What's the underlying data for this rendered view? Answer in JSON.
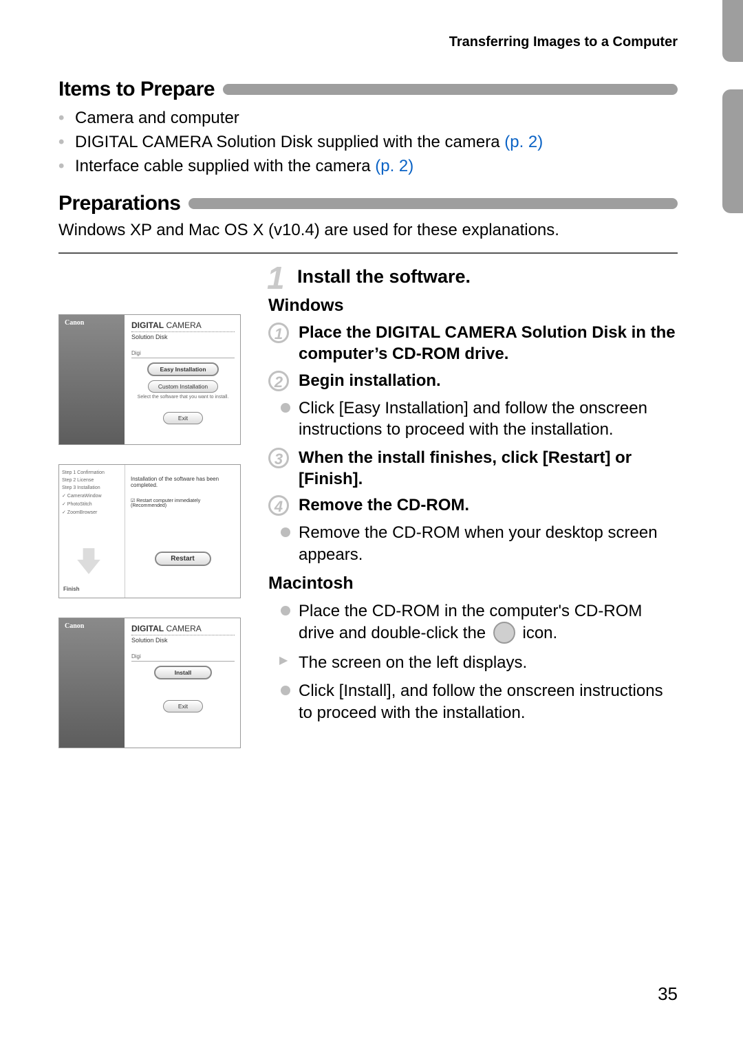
{
  "running_head": "Transferring Images to a Computer",
  "page_number": "35",
  "sections": {
    "items": {
      "title": "Items to Prepare",
      "bullets": [
        {
          "text": "Camera and computer"
        },
        {
          "text": "DIGITAL CAMERA Solution Disk supplied with the camera ",
          "ref": "(p. 2)"
        },
        {
          "text": "Interface cable supplied with the camera ",
          "ref": "(p. 2)"
        }
      ]
    },
    "prep": {
      "title": "Preparations",
      "intro": "Windows XP and Mac OS X (v10.4) are used for these explanations."
    }
  },
  "step1": {
    "num": "1",
    "title": "Install the software.",
    "windows": {
      "heading": "Windows",
      "s1": "Place the DIGITAL CAMERA Solution Disk in the computer’s CD-ROM drive.",
      "s2": "Begin installation.",
      "s2_detail": "Click [Easy Installation] and follow the onscreen instructions to proceed with the installation.",
      "s3": "When the install finishes, click [Restart] or [Finish].",
      "s4": "Remove the CD-ROM.",
      "s4_detail": "Remove the CD-ROM when your desktop screen appears."
    },
    "mac": {
      "heading": "Macintosh",
      "b1a": "Place the CD-ROM in the computer's CD-ROM drive and double-click the ",
      "b1b": " icon.",
      "b2": "The screen on the left displays.",
      "b3": "Click [Install], and follow the onscreen instructions to proceed with the installation."
    }
  },
  "figs": {
    "brand": "Canon",
    "dc_title_bold": "DIGITAL",
    "dc_title_rest": " CAMERA",
    "dc_sub": "Solution Disk",
    "catA": "Digi",
    "easy": "Easy Installation",
    "custom": "Custom Installation",
    "hint": "Select the software that you want to install.",
    "exit": "Exit",
    "install": "Install",
    "restart": "Restart",
    "finish_label": "Finish",
    "completed_msg": "Installation of the software has been completed.",
    "chk": "☑ Restart computer immediately (Recommended)",
    "side_steps": [
      "Step 1  Confirmation",
      "Step 2  License",
      "Step 3  Installation",
      "    ✓ CameraWindow",
      "    ✓ PhotoStitch",
      "    ✓ ZoomBrowser"
    ]
  }
}
